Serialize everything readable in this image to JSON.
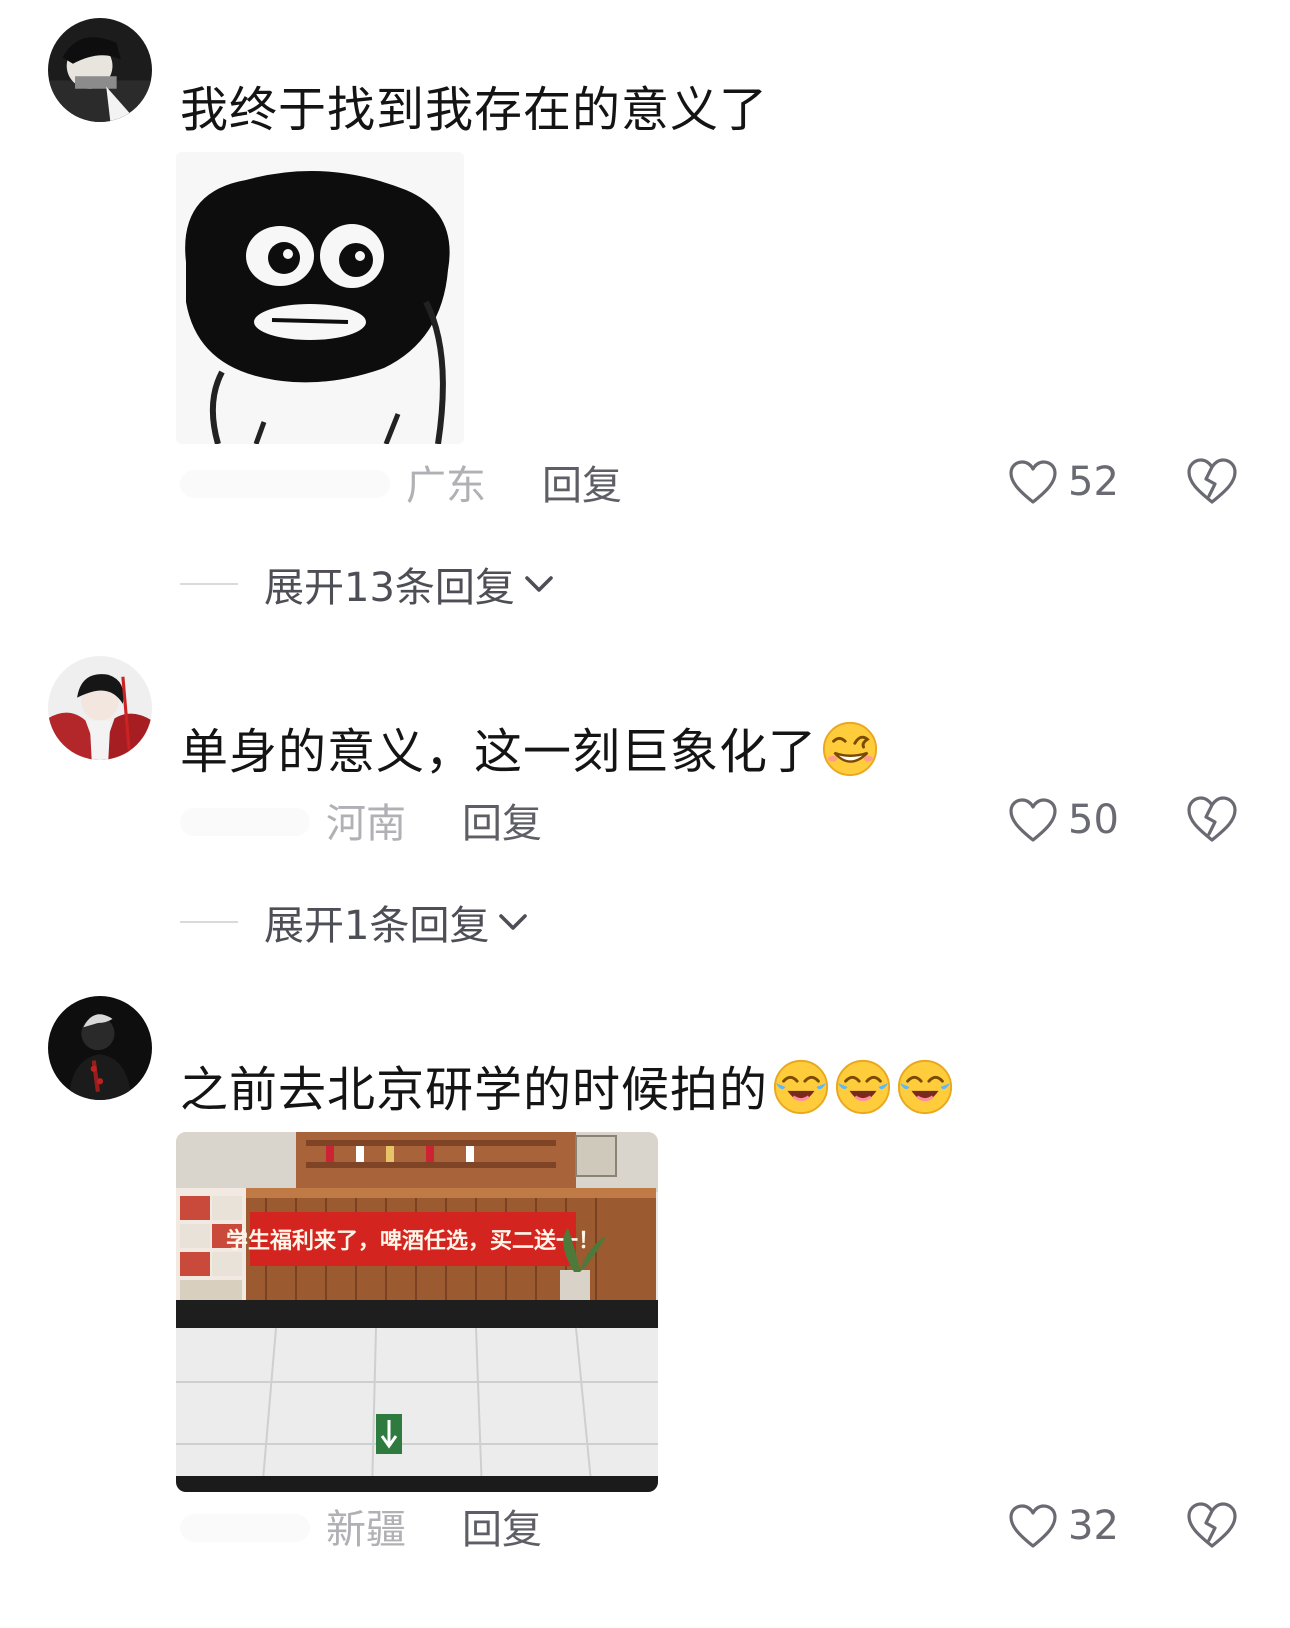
{
  "comments": [
    {
      "text": "我终于找到我存在的意义了",
      "location": "广东",
      "reply_label": "回复",
      "likes": "52",
      "expand_label": "展开13条回复"
    },
    {
      "text": "单身的意义，这一刻巨象化了",
      "location": "河南",
      "reply_label": "回复",
      "likes": "50",
      "expand_label": "展开1条回复"
    },
    {
      "text": "之前去北京研学的时候拍的",
      "location": "新疆",
      "reply_label": "回复",
      "likes": "32"
    }
  ],
  "photo": {
    "banner_text": "学生福利来了，啤酒任选，买二送一！"
  },
  "icons": {
    "like": "heart-outline-icon",
    "dislike": "broken-heart-icon",
    "expand": "chevron-down-icon"
  }
}
